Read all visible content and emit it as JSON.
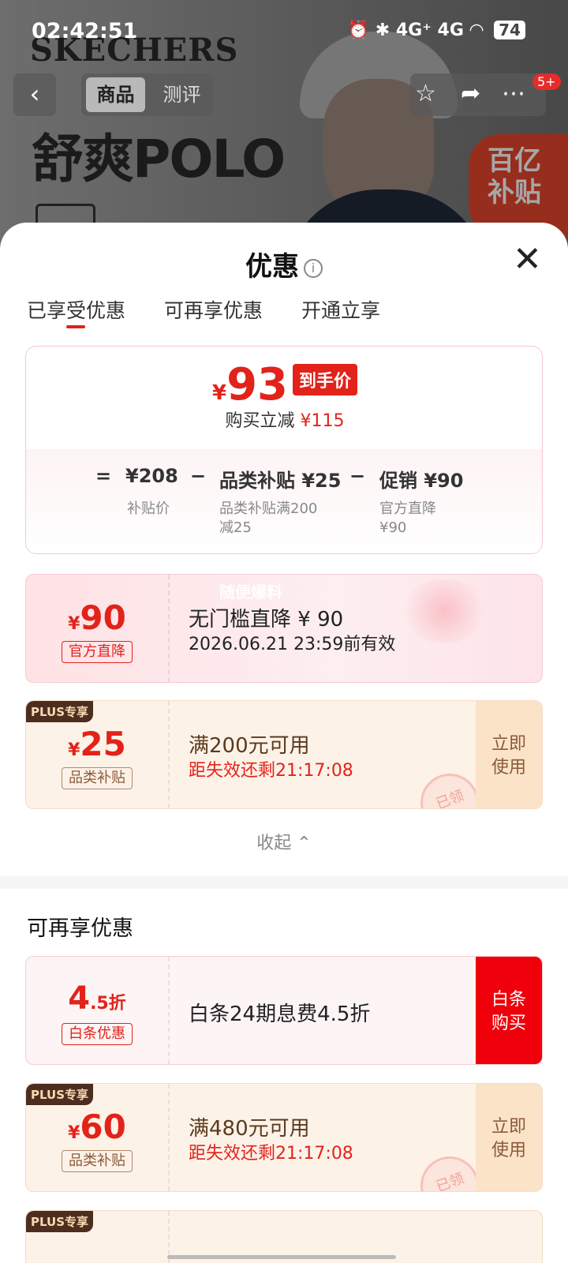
{
  "status_bar": {
    "time": "02:42:51",
    "signal": "4G⁺ 4G",
    "battery": "74"
  },
  "background": {
    "brand": "SKECHERS",
    "headline": "舒爽POLO",
    "badge_line1": "百亿",
    "badge_line2": "补贴"
  },
  "nav": {
    "back": "‹",
    "tab_active": "商品",
    "tab_inactive": "测评",
    "badge": "5+"
  },
  "sheet": {
    "title": "优惠",
    "close": "✕",
    "tabs": [
      "已享受优惠",
      "可再享优惠",
      "开通立享"
    ]
  },
  "summary": {
    "currency": "¥",
    "final_price": "93",
    "final_tag": "到手价",
    "save_label": "购买立减",
    "save_value": "¥115",
    "eq": "=",
    "base_price": "¥208",
    "base_label": "补贴价",
    "minus1": "−",
    "item1": "品类补贴 ¥25",
    "item1_desc_1": "品类补贴满200",
    "item1_desc_2": "减25",
    "minus2": "−",
    "item2": "促销 ¥90",
    "item2_desc_1": "官方直降",
    "item2_desc_2": "¥90"
  },
  "coupons_used": [
    {
      "currency": "¥",
      "amount": "90",
      "label": "官方直降",
      "title": "无门槛直降 ¥ 90",
      "subtitle": "2026.06.21 23:59前有效",
      "watermark": "随便爆料"
    },
    {
      "plus": "PLUS专享",
      "currency": "¥",
      "amount": "25",
      "label": "品类补贴",
      "title": "满200元可用",
      "subtitle": "距失效还剩21:17:08",
      "action_1": "立即",
      "action_2": "使用",
      "stamp": "已领"
    }
  ],
  "collapse": "收起 ⌃",
  "more_section_title": "可再享优惠",
  "coupons_more": [
    {
      "amount": "4",
      "suffix": ".5折",
      "label": "白条优惠",
      "title": "白条24期息费4.5折",
      "action_1": "白条",
      "action_2": "购买"
    },
    {
      "plus": "PLUS专享",
      "currency": "¥",
      "amount": "60",
      "label": "品类补贴",
      "title": "满480元可用",
      "subtitle": "距失效还剩21:17:08",
      "action_1": "立即",
      "action_2": "使用",
      "stamp": "已领"
    },
    {
      "plus": "PLUS专享"
    }
  ]
}
